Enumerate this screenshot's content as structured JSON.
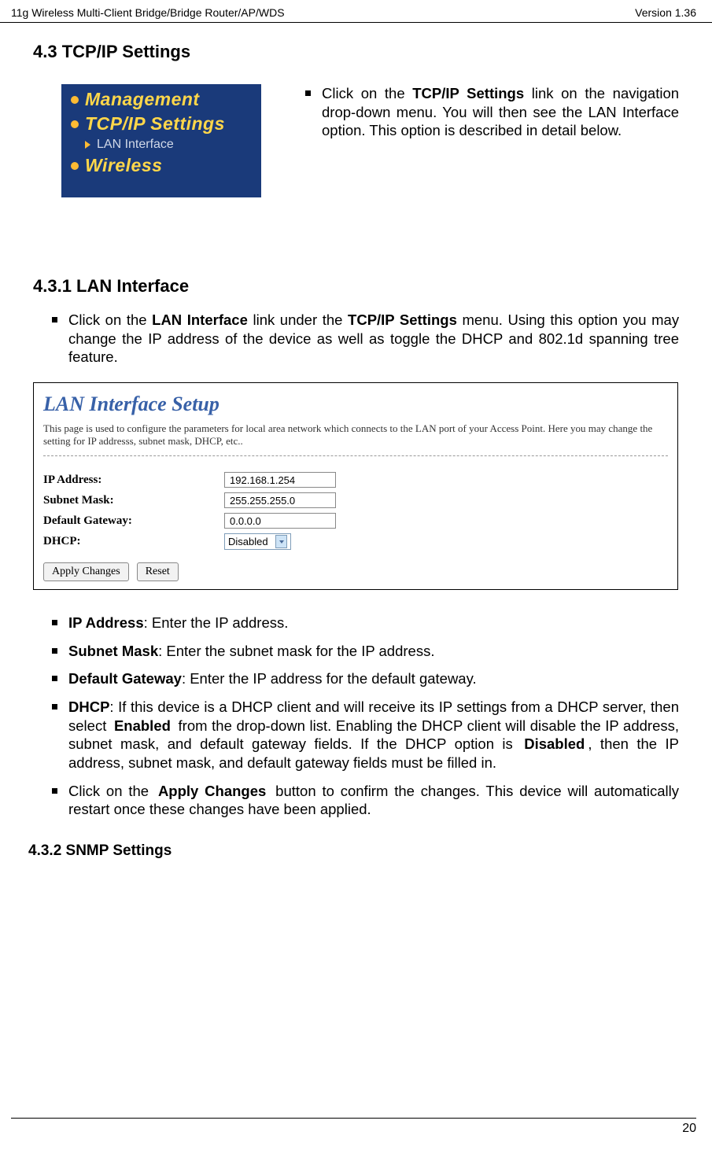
{
  "header": {
    "left": "11g Wireless Multi-Client Bridge/Bridge Router/AP/WDS",
    "right": "Version 1.36"
  },
  "section_43": {
    "heading": "4.3   TCP/IP Settings",
    "nav_items": {
      "mgmt": "Management",
      "tcpip": "TCP/IP Settings",
      "lan": "LAN Interface",
      "wireless": "Wireless"
    },
    "right_bullet_pre": "Click on the",
    "right_bullet_bold": "TCP/IP Settings",
    "right_bullet_post": "link on the navigation drop-down menu. You will then see the LAN Interface option. This option is described in detail below."
  },
  "section_431": {
    "heading": "4.3.1  LAN Interface",
    "intro_pre": "Click on the",
    "intro_bold1": "LAN Interface",
    "intro_mid": "link under the",
    "intro_bold2": "TCP/IP Settings",
    "intro_post": "menu. Using this option you may change the IP address of the device as well as toggle the DHCP and 802.1d spanning tree feature.",
    "lan_panel": {
      "title": "LAN Interface Setup",
      "desc": "This page is used to configure the parameters for local area network which connects to the LAN port of your Access Point. Here you may change the setting for IP addresss, subnet mask, DHCP, etc..",
      "fields": {
        "ip_label": "IP Address:",
        "ip_value": "192.168.1.254",
        "mask_label": "Subnet Mask:",
        "mask_value": "255.255.255.0",
        "gw_label": "Default Gateway:",
        "gw_value": "0.0.0.0",
        "dhcp_label": "DHCP:",
        "dhcp_value": "Disabled"
      },
      "buttons": {
        "apply": "Apply Changes",
        "reset": "Reset"
      }
    },
    "bullets": {
      "ip_label": "IP Address",
      "ip_text": ": Enter the IP address.",
      "mask_label": "Subnet Mask",
      "mask_text": ": Enter the subnet mask for the IP address.",
      "gw_label": "Default Gateway",
      "gw_text": ": Enter the IP address for the default gateway.",
      "dhcp_label": "DHCP",
      "dhcp_pre": ": If this device is a DHCP client and will receive its IP settings from a DHCP server, then select",
      "dhcp_enabled": "Enabled",
      "dhcp_mid": "from the drop-down list. Enabling the DHCP client will disable the IP address, subnet mask, and default gateway fields. If the DHCP option is",
      "dhcp_disabled": "Disabled",
      "dhcp_post": ", then the IP address, subnet mask, and default gateway fields must be filled in.",
      "apply_pre": "Click on the",
      "apply_bold": "Apply Changes",
      "apply_post": "button to confirm the changes. This device will automatically restart once these changes have been applied."
    }
  },
  "section_432": {
    "heading": "4.3.2 SNMP Settings"
  },
  "footer": {
    "page": "20"
  }
}
